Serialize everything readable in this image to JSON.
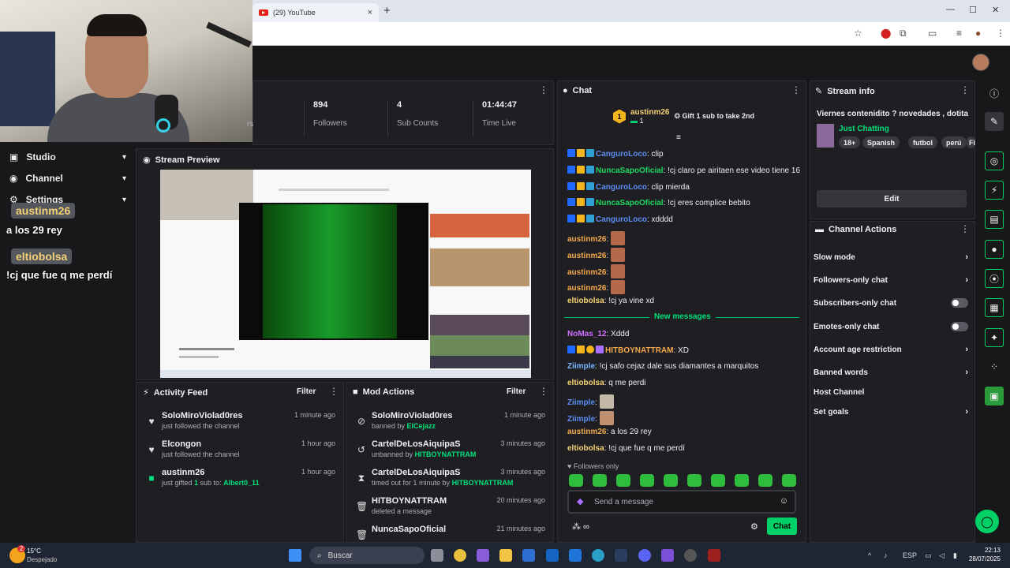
{
  "browser": {
    "tab_title": "(29) YouTube",
    "tab_close": "×",
    "new_tab": "+",
    "win_min": "—",
    "win_max": "☐",
    "win_close": "✕"
  },
  "nav": {
    "items": [
      {
        "label": "Studio",
        "icon": "studio-icon"
      },
      {
        "label": "Channel",
        "icon": "channel-icon"
      },
      {
        "label": "Settings",
        "icon": "settings-icon"
      }
    ]
  },
  "overlay_chat": [
    {
      "user": "austinm26",
      "message": "a los 29 rey"
    },
    {
      "user": "eltiobolsa",
      "message": "!cj que fue q me perdí"
    }
  ],
  "stats": [
    {
      "value": "894",
      "label": "Followers"
    },
    {
      "value": "4",
      "label": "Sub Counts"
    },
    {
      "value": "01:44:47",
      "label": "Time Live"
    }
  ],
  "stats_partial_label": "rs",
  "preview": {
    "title": "Stream Preview"
  },
  "activity": {
    "title": "Activity Feed",
    "filter": "Filter",
    "items": [
      {
        "name": "SoloMiroViolad0res",
        "sub": "just followed the channel",
        "time": "1 minute ago",
        "icon": "heart-icon"
      },
      {
        "name": "Elcongon",
        "sub": "just followed the channel",
        "time": "1 hour ago",
        "icon": "heart-icon"
      },
      {
        "name": "austinm26",
        "sub_pre": "just gifted ",
        "sub_count": "1",
        "sub_mid": " sub to: ",
        "sub_target": "Albert0_11",
        "time": "1 hour ago",
        "icon": "gift-icon"
      }
    ]
  },
  "mod": {
    "title": "Mod Actions",
    "filter": "Filter",
    "items": [
      {
        "name": "SoloMiroViolad0res",
        "action": "banned by ",
        "by": "ElCejazz",
        "time": "1 minute ago",
        "icon": "ban-icon"
      },
      {
        "name": "CartelDeLosAiquipaS",
        "action": "unbanned by ",
        "by": "HITBOYNATTRAM",
        "time": "3 minutes ago",
        "icon": "undo-icon"
      },
      {
        "name": "CartelDeLosAiquipaS",
        "action": "timed out for 1 minute by ",
        "by": "HITBOYNATTRAM",
        "time": "3 minutes ago",
        "icon": "hourglass-icon"
      },
      {
        "name": "HITBOYNATTRAM",
        "action": "deleted a message",
        "by": "",
        "time": "20 minutes ago",
        "icon": "trash-icon"
      },
      {
        "name": "NuncaSapoOficial",
        "action": "",
        "by": "",
        "time": "21 minutes ago",
        "icon": "trash-icon"
      }
    ]
  },
  "chat": {
    "title": "Chat",
    "hype": {
      "rank": "1",
      "user": "austinm26",
      "count": "1",
      "text": "Gift 1 sub to take 2nd"
    },
    "lines": [
      {
        "user": "CanguroLoco",
        "text": ": clip"
      },
      {
        "user": "NuncaSapoOficial",
        "text": ": !cj claro pe airitaen ese video tiene 16"
      },
      {
        "user": "CanguroLoco",
        "text": ": clip mierda"
      },
      {
        "user": "NuncaSapoOficial",
        "text": ": !cj eres complice bebito"
      },
      {
        "user": "CanguroLoco",
        "text": ": xdddd"
      },
      {
        "user": "austinm26",
        "text": ":"
      },
      {
        "user": "austinm26",
        "text": ":"
      },
      {
        "user": "austinm26",
        "text": ":"
      },
      {
        "user": "austinm26",
        "text": ":"
      },
      {
        "user": "eltiobolsa",
        "text": ": !cj ya vine xd"
      },
      {
        "user": "NoMas_12",
        "text": ": Xddd"
      },
      {
        "user": "HITBOYNATTRAM",
        "text": ": XD"
      },
      {
        "user": "Ziimple",
        "text": ": !cj safo cejaz dale sus diamantes a marquitos"
      },
      {
        "user": "eltiobolsa",
        "text": ": q me perdi"
      },
      {
        "user": "Ziimple",
        "text": ":"
      },
      {
        "user": "Ziimple",
        "text": ":"
      },
      {
        "user": "austinm26",
        "text": ": a los 29 rey"
      },
      {
        "user": "eltiobolsa",
        "text": ": !cj que fue q me perdí"
      }
    ],
    "new_messages": "New messages",
    "followers_only": "Followers only",
    "placeholder": "Send a message",
    "send": "Chat"
  },
  "stream_info": {
    "title": "Stream info",
    "stream_title": "Viernes contenidito ? novedades , dotita",
    "category": "Just Chatting",
    "tags": [
      "18+",
      "Spanish",
      "futbol",
      "perú",
      "Fi"
    ],
    "edit": "Edit"
  },
  "channel_actions": {
    "title": "Channel Actions",
    "items": [
      {
        "label": "Slow mode",
        "kind": "arrow"
      },
      {
        "label": "Followers-only chat",
        "kind": "arrow"
      },
      {
        "label": "Subscribers-only chat",
        "kind": "toggle"
      },
      {
        "label": "Emotes-only chat",
        "kind": "toggle"
      },
      {
        "label": "Account age restriction",
        "kind": "arrow"
      },
      {
        "label": "Banned words",
        "kind": "arrow"
      },
      {
        "label": "Host Channel",
        "kind": "none"
      },
      {
        "label": "Set goals",
        "kind": "arrow"
      }
    ]
  },
  "taskbar": {
    "weather_temp": "15°C",
    "weather_desc": "Despejado",
    "weather_badge": "2",
    "search": "Buscar",
    "lang": "ESP",
    "time": "22:13",
    "date": "28/07/2025"
  },
  "colors": {
    "twitch_green": "#00d166",
    "mod_blue": "#1f69ff",
    "sub_gold": "#f2b51c"
  }
}
